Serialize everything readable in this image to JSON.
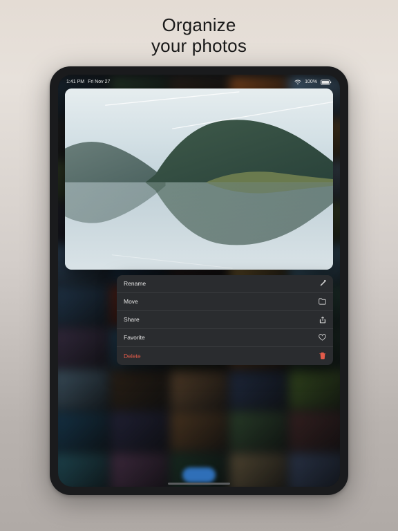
{
  "headline": {
    "line1": "Organize",
    "line2": "your photos"
  },
  "status": {
    "time": "1:41 PM",
    "date": "Fri Nov 27",
    "battery": "100%"
  },
  "menu": {
    "rename": {
      "label": "Rename"
    },
    "move": {
      "label": "Move"
    },
    "share": {
      "label": "Share"
    },
    "favorite": {
      "label": "Favorite"
    },
    "delete": {
      "label": "Delete"
    }
  },
  "grid_colors": [
    "#2a3e4f",
    "#3e5a44",
    "#45382c",
    "#d07838",
    "#7aa3c7",
    "#2f2f2f",
    "#3a6a4f",
    "#9a6a3c",
    "#3c2c2a",
    "#b88a4a",
    "#4a5a3a",
    "#3e8a9a",
    "#c0a060",
    "#6a4a3a",
    "#8aa0b8",
    "#2c2c3a",
    "#3a8a6a",
    "#3a3a3a",
    "#c0602a",
    "#7a8a4a",
    "#4a6a8a",
    "#2a4a6a",
    "#3a2a2a",
    "#d0a85a",
    "#6aa0c0",
    "#3a5a7a",
    "#8a3a2a",
    "#2a2a3a",
    "#b8885a",
    "#4a7a6a",
    "#5a4a6a",
    "#3a6a8a",
    "#2a3a2a",
    "#c07a3a",
    "#3a5a4a",
    "#6a8aa0",
    "#4a3a2a",
    "#8a6a4a",
    "#3a4a6a",
    "#5a7a3a",
    "#2a5a7a",
    "#3a3a5a",
    "#7a5a3a",
    "#4a6a4a",
    "#5a3a3a",
    "#3a7a8a",
    "#6a4a6a",
    "#2a4a3a",
    "#8a7a5a",
    "#4a5a7a"
  ]
}
